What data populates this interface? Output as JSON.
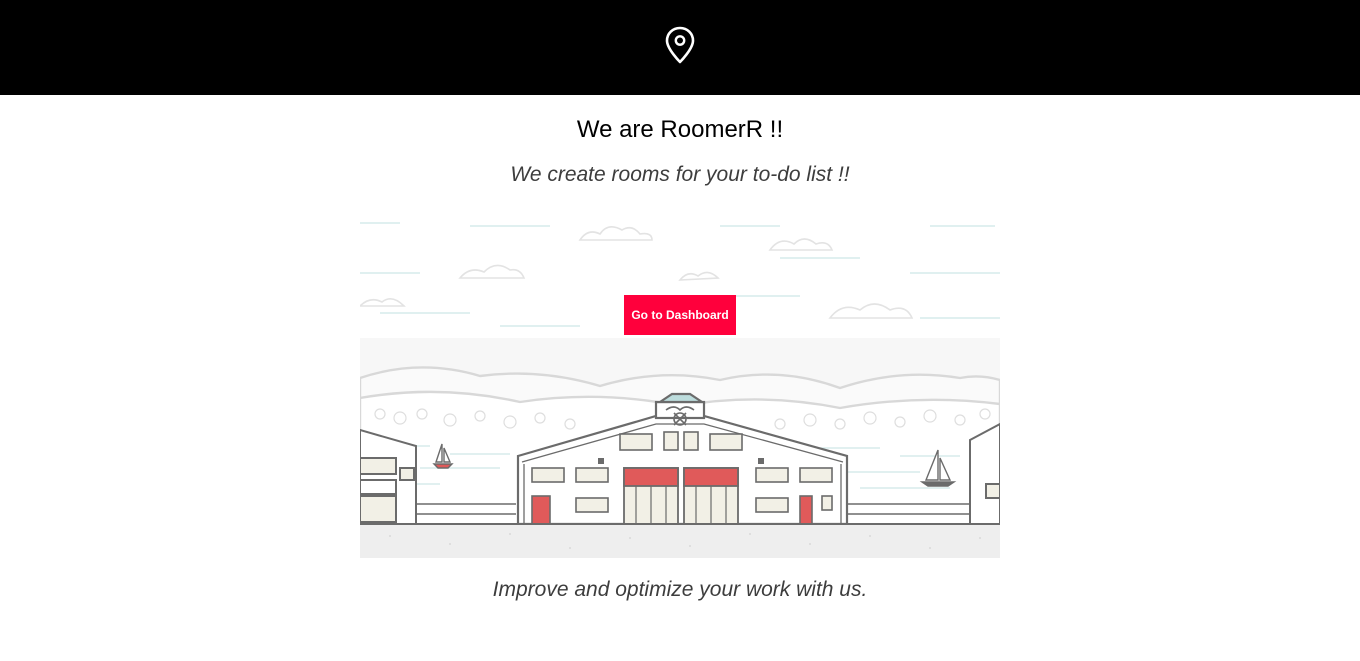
{
  "header": {
    "icon": "map-pin-icon",
    "background": "#000000"
  },
  "hero": {
    "title": "We are RoomerR !!",
    "subtitle": "We create rooms for your to-do list !!",
    "cta_label": "Go to Dashboard",
    "cta_color": "#ff003c",
    "illustration": "warehouse-pier-illustration"
  },
  "footer": {
    "tagline": "Improve and optimize your work with us."
  }
}
